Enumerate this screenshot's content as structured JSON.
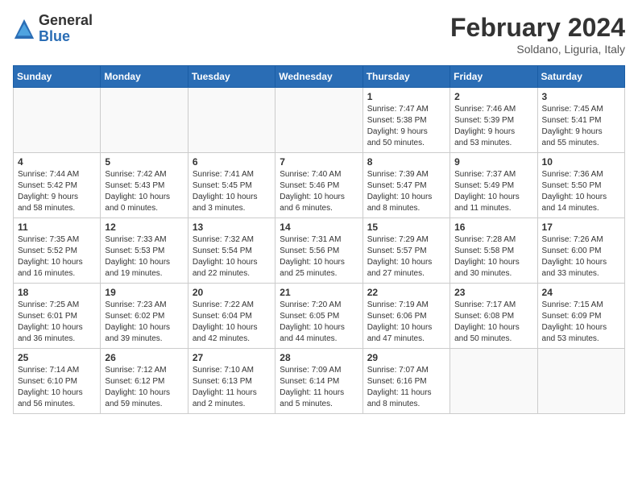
{
  "header": {
    "logo_general": "General",
    "logo_blue": "Blue",
    "main_title": "February 2024",
    "subtitle": "Soldano, Liguria, Italy"
  },
  "days_of_week": [
    "Sunday",
    "Monday",
    "Tuesday",
    "Wednesday",
    "Thursday",
    "Friday",
    "Saturday"
  ],
  "weeks": [
    [
      {
        "day": "",
        "info": ""
      },
      {
        "day": "",
        "info": ""
      },
      {
        "day": "",
        "info": ""
      },
      {
        "day": "",
        "info": ""
      },
      {
        "day": "1",
        "info": "Sunrise: 7:47 AM\nSunset: 5:38 PM\nDaylight: 9 hours\nand 50 minutes."
      },
      {
        "day": "2",
        "info": "Sunrise: 7:46 AM\nSunset: 5:39 PM\nDaylight: 9 hours\nand 53 minutes."
      },
      {
        "day": "3",
        "info": "Sunrise: 7:45 AM\nSunset: 5:41 PM\nDaylight: 9 hours\nand 55 minutes."
      }
    ],
    [
      {
        "day": "4",
        "info": "Sunrise: 7:44 AM\nSunset: 5:42 PM\nDaylight: 9 hours\nand 58 minutes."
      },
      {
        "day": "5",
        "info": "Sunrise: 7:42 AM\nSunset: 5:43 PM\nDaylight: 10 hours\nand 0 minutes."
      },
      {
        "day": "6",
        "info": "Sunrise: 7:41 AM\nSunset: 5:45 PM\nDaylight: 10 hours\nand 3 minutes."
      },
      {
        "day": "7",
        "info": "Sunrise: 7:40 AM\nSunset: 5:46 PM\nDaylight: 10 hours\nand 6 minutes."
      },
      {
        "day": "8",
        "info": "Sunrise: 7:39 AM\nSunset: 5:47 PM\nDaylight: 10 hours\nand 8 minutes."
      },
      {
        "day": "9",
        "info": "Sunrise: 7:37 AM\nSunset: 5:49 PM\nDaylight: 10 hours\nand 11 minutes."
      },
      {
        "day": "10",
        "info": "Sunrise: 7:36 AM\nSunset: 5:50 PM\nDaylight: 10 hours\nand 14 minutes."
      }
    ],
    [
      {
        "day": "11",
        "info": "Sunrise: 7:35 AM\nSunset: 5:52 PM\nDaylight: 10 hours\nand 16 minutes."
      },
      {
        "day": "12",
        "info": "Sunrise: 7:33 AM\nSunset: 5:53 PM\nDaylight: 10 hours\nand 19 minutes."
      },
      {
        "day": "13",
        "info": "Sunrise: 7:32 AM\nSunset: 5:54 PM\nDaylight: 10 hours\nand 22 minutes."
      },
      {
        "day": "14",
        "info": "Sunrise: 7:31 AM\nSunset: 5:56 PM\nDaylight: 10 hours\nand 25 minutes."
      },
      {
        "day": "15",
        "info": "Sunrise: 7:29 AM\nSunset: 5:57 PM\nDaylight: 10 hours\nand 27 minutes."
      },
      {
        "day": "16",
        "info": "Sunrise: 7:28 AM\nSunset: 5:58 PM\nDaylight: 10 hours\nand 30 minutes."
      },
      {
        "day": "17",
        "info": "Sunrise: 7:26 AM\nSunset: 6:00 PM\nDaylight: 10 hours\nand 33 minutes."
      }
    ],
    [
      {
        "day": "18",
        "info": "Sunrise: 7:25 AM\nSunset: 6:01 PM\nDaylight: 10 hours\nand 36 minutes."
      },
      {
        "day": "19",
        "info": "Sunrise: 7:23 AM\nSunset: 6:02 PM\nDaylight: 10 hours\nand 39 minutes."
      },
      {
        "day": "20",
        "info": "Sunrise: 7:22 AM\nSunset: 6:04 PM\nDaylight: 10 hours\nand 42 minutes."
      },
      {
        "day": "21",
        "info": "Sunrise: 7:20 AM\nSunset: 6:05 PM\nDaylight: 10 hours\nand 44 minutes."
      },
      {
        "day": "22",
        "info": "Sunrise: 7:19 AM\nSunset: 6:06 PM\nDaylight: 10 hours\nand 47 minutes."
      },
      {
        "day": "23",
        "info": "Sunrise: 7:17 AM\nSunset: 6:08 PM\nDaylight: 10 hours\nand 50 minutes."
      },
      {
        "day": "24",
        "info": "Sunrise: 7:15 AM\nSunset: 6:09 PM\nDaylight: 10 hours\nand 53 minutes."
      }
    ],
    [
      {
        "day": "25",
        "info": "Sunrise: 7:14 AM\nSunset: 6:10 PM\nDaylight: 10 hours\nand 56 minutes."
      },
      {
        "day": "26",
        "info": "Sunrise: 7:12 AM\nSunset: 6:12 PM\nDaylight: 10 hours\nand 59 minutes."
      },
      {
        "day": "27",
        "info": "Sunrise: 7:10 AM\nSunset: 6:13 PM\nDaylight: 11 hours\nand 2 minutes."
      },
      {
        "day": "28",
        "info": "Sunrise: 7:09 AM\nSunset: 6:14 PM\nDaylight: 11 hours\nand 5 minutes."
      },
      {
        "day": "29",
        "info": "Sunrise: 7:07 AM\nSunset: 6:16 PM\nDaylight: 11 hours\nand 8 minutes."
      },
      {
        "day": "",
        "info": ""
      },
      {
        "day": "",
        "info": ""
      }
    ]
  ]
}
